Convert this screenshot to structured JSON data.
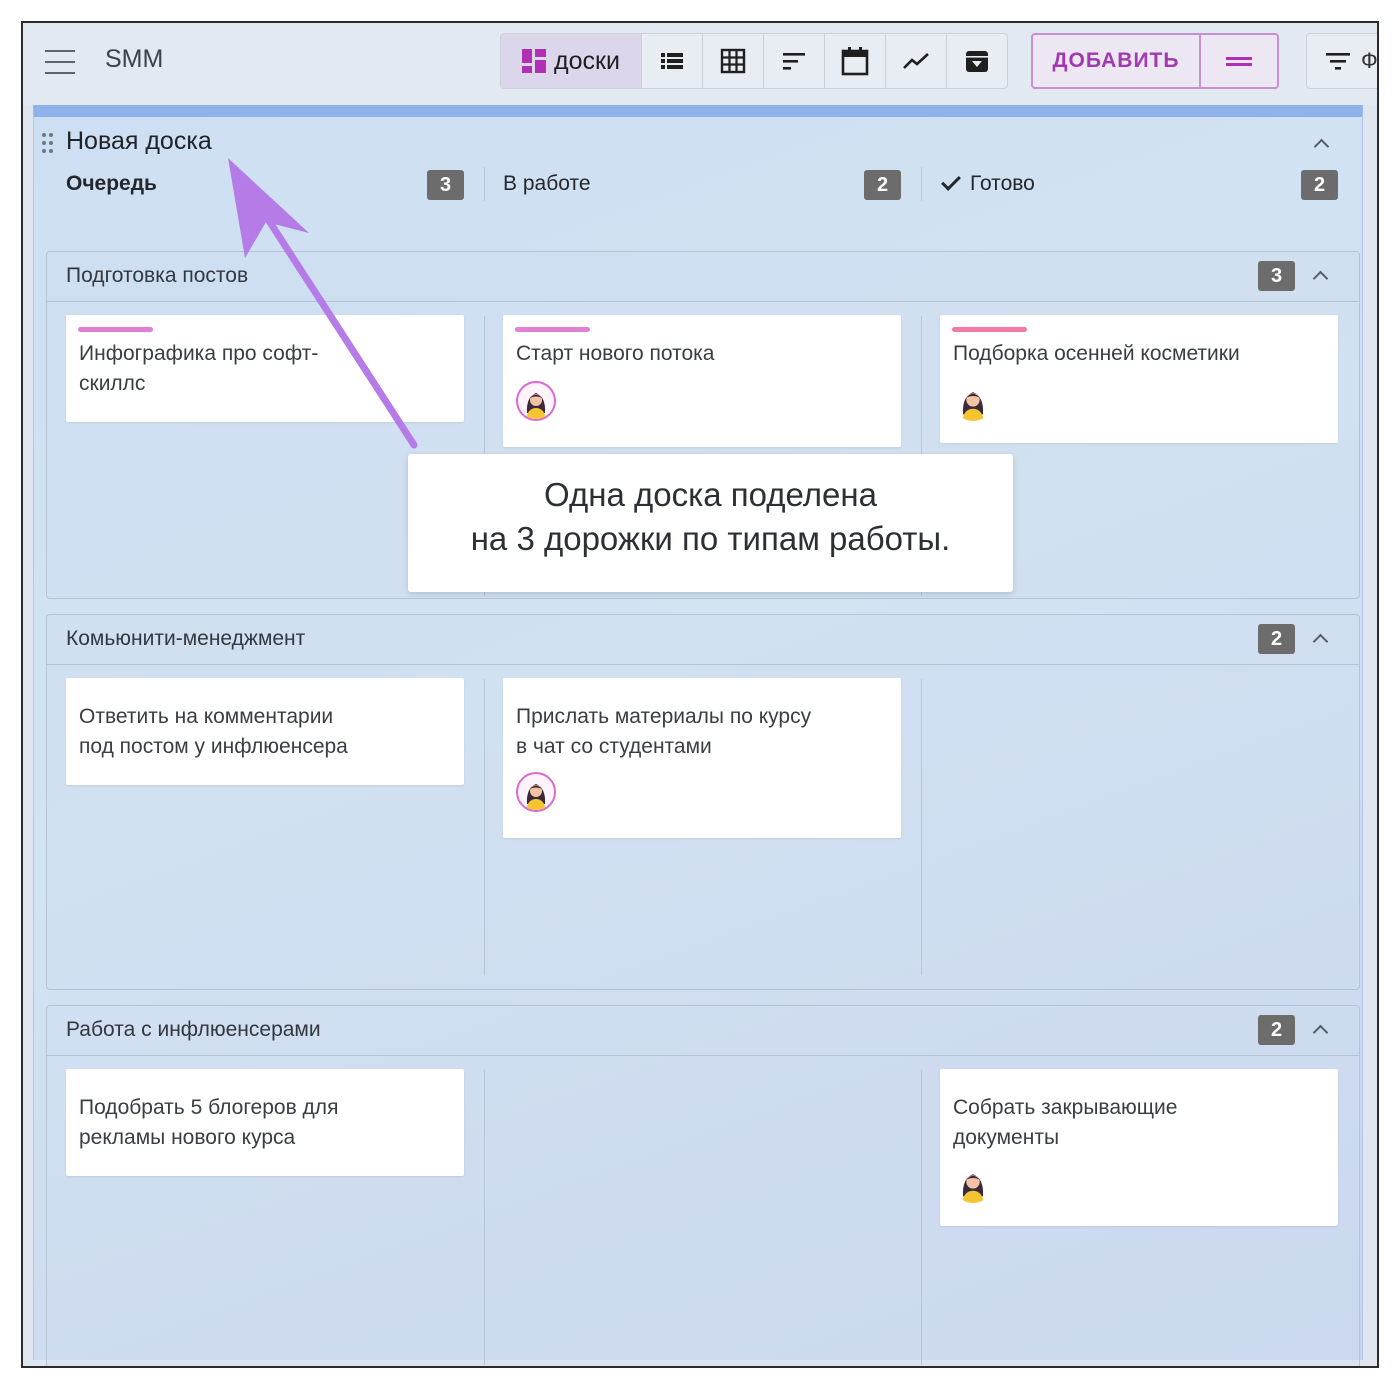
{
  "app": {
    "title": "SMM"
  },
  "toolbar": {
    "views": [
      {
        "name": "boards",
        "label": "доски",
        "icon": "dashboard-icon",
        "active": true
      },
      {
        "name": "list",
        "icon": "list-icon"
      },
      {
        "name": "table",
        "icon": "grid-icon"
      },
      {
        "name": "gantt",
        "icon": "sort-lines-icon"
      },
      {
        "name": "calendar",
        "icon": "calendar-icon"
      },
      {
        "name": "chart",
        "icon": "trend-icon"
      },
      {
        "name": "archive",
        "icon": "archive-icon"
      }
    ],
    "add_label": "ДОБАВИТЬ",
    "add_menu_icon": "equals-icon",
    "filter_label": "Ф",
    "filter_icon": "filter-icon"
  },
  "board": {
    "title": "Новая доска",
    "columns": [
      {
        "name": "Очередь",
        "count": "3"
      },
      {
        "name": "В работе",
        "count": "2"
      },
      {
        "name": "Готово",
        "count": "2",
        "icon": "check-icon"
      }
    ],
    "lanes": [
      {
        "title": "Подготовка постов",
        "count": "3",
        "cards": [
          {
            "text": "Инфографика про софт-\nскиллс",
            "strip": "#e07fd6",
            "avatar": false
          },
          {
            "text": "Старт нового потока",
            "strip": "#e07fd6",
            "avatar": true
          },
          {
            "text": "Подборка осенней косметики",
            "strip": "#f47aa6",
            "avatar": true
          }
        ]
      },
      {
        "title": "Комьюнити-менеджмент",
        "count": "2",
        "cards": [
          {
            "text": "Ответить на комментарии\nпод постом у инфлюенсера",
            "avatar": false
          },
          {
            "text": "Прислать материалы по курсу\nв чат со студентами",
            "avatar": true
          }
        ]
      },
      {
        "title": "Работа с инфлюенсерами",
        "count": "2",
        "cards": [
          {
            "text": "Подобрать 5 блогеров для\nрекламы нового курса",
            "avatar": false
          },
          {
            "text": "Собрать закрывающие\nдокументы",
            "avatar": true
          }
        ]
      }
    ]
  },
  "callout": {
    "line1": "Одна доска поделена",
    "line2": "на 3 дорожки по типам работы."
  },
  "colors": {
    "accent": "#b12fb4",
    "arrow": "#b57be6",
    "badge": "#6c6c6c"
  }
}
